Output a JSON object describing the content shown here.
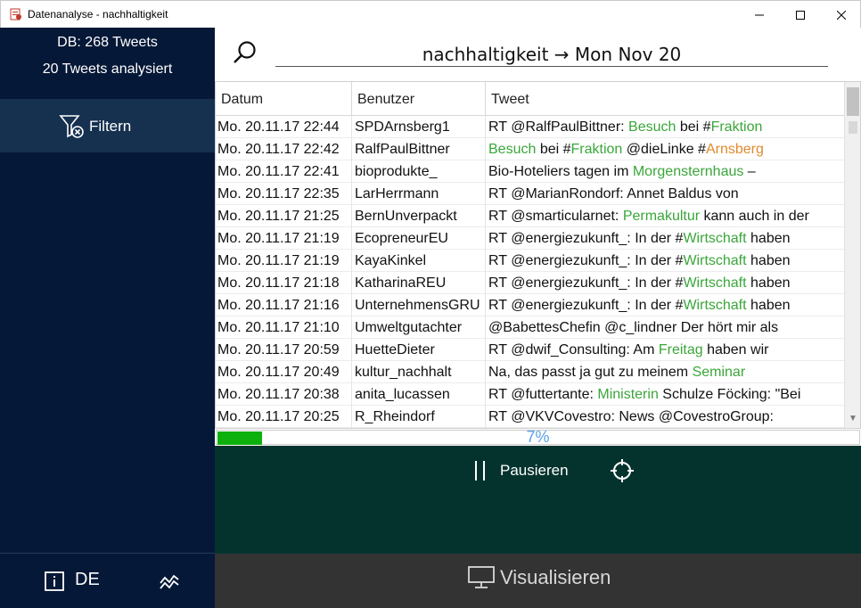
{
  "window": {
    "title": "Datenanalyse - nachhaltigkeit",
    "controls": {
      "minimize": "–",
      "maximize": "☐",
      "close": "✕"
    }
  },
  "sidebar": {
    "db_count": "DB: 268 Tweets",
    "analyzed": "20 Tweets analysiert",
    "filter_label": "Filtern",
    "language": "DE",
    "icons": [
      "filter-remove-icon",
      "info-icon",
      "chart-line-icon"
    ]
  },
  "search": {
    "value": "nachhaltigkeit → Mon Nov 20",
    "icon": "search-icon"
  },
  "table": {
    "columns": [
      "Datum",
      "Benutzer",
      "Tweet"
    ],
    "rows": [
      {
        "date": "Mo. 20.11.17 22:44",
        "user": "SPDArnsberg1",
        "tweet": [
          {
            "t": "RT @RalfPaulBittner: ",
            "c": ""
          },
          {
            "t": "Besuch",
            "c": "green"
          },
          {
            "t": " bei #",
            "c": ""
          },
          {
            "t": "Fraktion",
            "c": "green"
          }
        ]
      },
      {
        "date": "Mo. 20.11.17 22:42",
        "user": "RalfPaulBittner",
        "tweet": [
          {
            "t": "Besuch",
            "c": "green"
          },
          {
            "t": " bei #",
            "c": ""
          },
          {
            "t": "Fraktion",
            "c": "green"
          },
          {
            "t": " @dieLinke #",
            "c": ""
          },
          {
            "t": "Arnsberg",
            "c": "orange"
          }
        ]
      },
      {
        "date": "Mo. 20.11.17 22:41",
        "user": "bioprodukte_",
        "tweet": [
          {
            "t": "Bio-Hoteliers tagen im ",
            "c": ""
          },
          {
            "t": "Morgensternhaus",
            "c": "green"
          },
          {
            "t": " –",
            "c": ""
          }
        ]
      },
      {
        "date": "Mo. 20.11.17 22:35",
        "user": "LarHerrmann",
        "tweet": [
          {
            "t": "RT @MarianRondorf: Annet Baldus von",
            "c": ""
          }
        ]
      },
      {
        "date": "Mo. 20.11.17 21:25",
        "user": "BernUnverpackt",
        "tweet": [
          {
            "t": "RT @smarticularnet: ",
            "c": ""
          },
          {
            "t": "Permakultur",
            "c": "green"
          },
          {
            "t": " kann auch in der",
            "c": ""
          }
        ]
      },
      {
        "date": "Mo. 20.11.17 21:19",
        "user": "EcopreneurEU",
        "tweet": [
          {
            "t": "RT @energiezukunft_: In der #",
            "c": ""
          },
          {
            "t": "Wirtschaft",
            "c": "green"
          },
          {
            "t": " haben",
            "c": ""
          }
        ]
      },
      {
        "date": "Mo. 20.11.17 21:19",
        "user": "KayaKinkel",
        "tweet": [
          {
            "t": "RT @energiezukunft_: In der #",
            "c": ""
          },
          {
            "t": "Wirtschaft",
            "c": "green"
          },
          {
            "t": " haben",
            "c": ""
          }
        ]
      },
      {
        "date": "Mo. 20.11.17 21:18",
        "user": "KatharinaREU",
        "tweet": [
          {
            "t": "RT @energiezukunft_: In der #",
            "c": ""
          },
          {
            "t": "Wirtschaft",
            "c": "green"
          },
          {
            "t": " haben",
            "c": ""
          }
        ]
      },
      {
        "date": "Mo. 20.11.17 21:16",
        "user": "UnternehmensGRU",
        "tweet": [
          {
            "t": "RT @energiezukunft_: In der #",
            "c": ""
          },
          {
            "t": "Wirtschaft",
            "c": "green"
          },
          {
            "t": " haben",
            "c": ""
          }
        ]
      },
      {
        "date": "Mo. 20.11.17 21:10",
        "user": "Umweltgutachter",
        "tweet": [
          {
            "t": "@BabettesChefin @c_lindner Der hört mir als",
            "c": ""
          }
        ]
      },
      {
        "date": "Mo. 20.11.17 20:59",
        "user": "HuetteDieter",
        "tweet": [
          {
            "t": "RT @dwif_Consulting: Am ",
            "c": ""
          },
          {
            "t": "Freitag",
            "c": "green"
          },
          {
            "t": " haben wir",
            "c": ""
          }
        ]
      },
      {
        "date": "Mo. 20.11.17 20:49",
        "user": "kultur_nachhalt",
        "tweet": [
          {
            "t": "Na, das passt ja gut zu meinem ",
            "c": ""
          },
          {
            "t": "Seminar",
            "c": "green"
          }
        ]
      },
      {
        "date": "Mo. 20.11.17 20:38",
        "user": "anita_lucassen",
        "tweet": [
          {
            "t": "RT @futtertante: ",
            "c": ""
          },
          {
            "t": "Ministerin",
            "c": "green"
          },
          {
            "t": " Schulze Föcking: \"Bei",
            "c": ""
          }
        ]
      },
      {
        "date": "Mo. 20.11.17 20:25",
        "user": "R_Rheindorf",
        "tweet": [
          {
            "t": "RT @VKVCovestro: News @CovestroGroup:",
            "c": ""
          }
        ]
      }
    ]
  },
  "progress": {
    "value": 0.07,
    "label": "7%",
    "color": "#0db00d"
  },
  "controls": {
    "pause_label": "Pausieren",
    "icons": [
      "pause-icon",
      "crosshair-icon"
    ]
  },
  "visualize": {
    "label": "Visualisieren",
    "icon": "monitor-icon"
  },
  "colors": {
    "sidebar": "#061837",
    "filter_active": "#163050",
    "controls_bg": "#04332e",
    "visual_bg": "#333333",
    "keyword_green": "#3aa63a",
    "keyword_orange": "#e08a2c"
  }
}
